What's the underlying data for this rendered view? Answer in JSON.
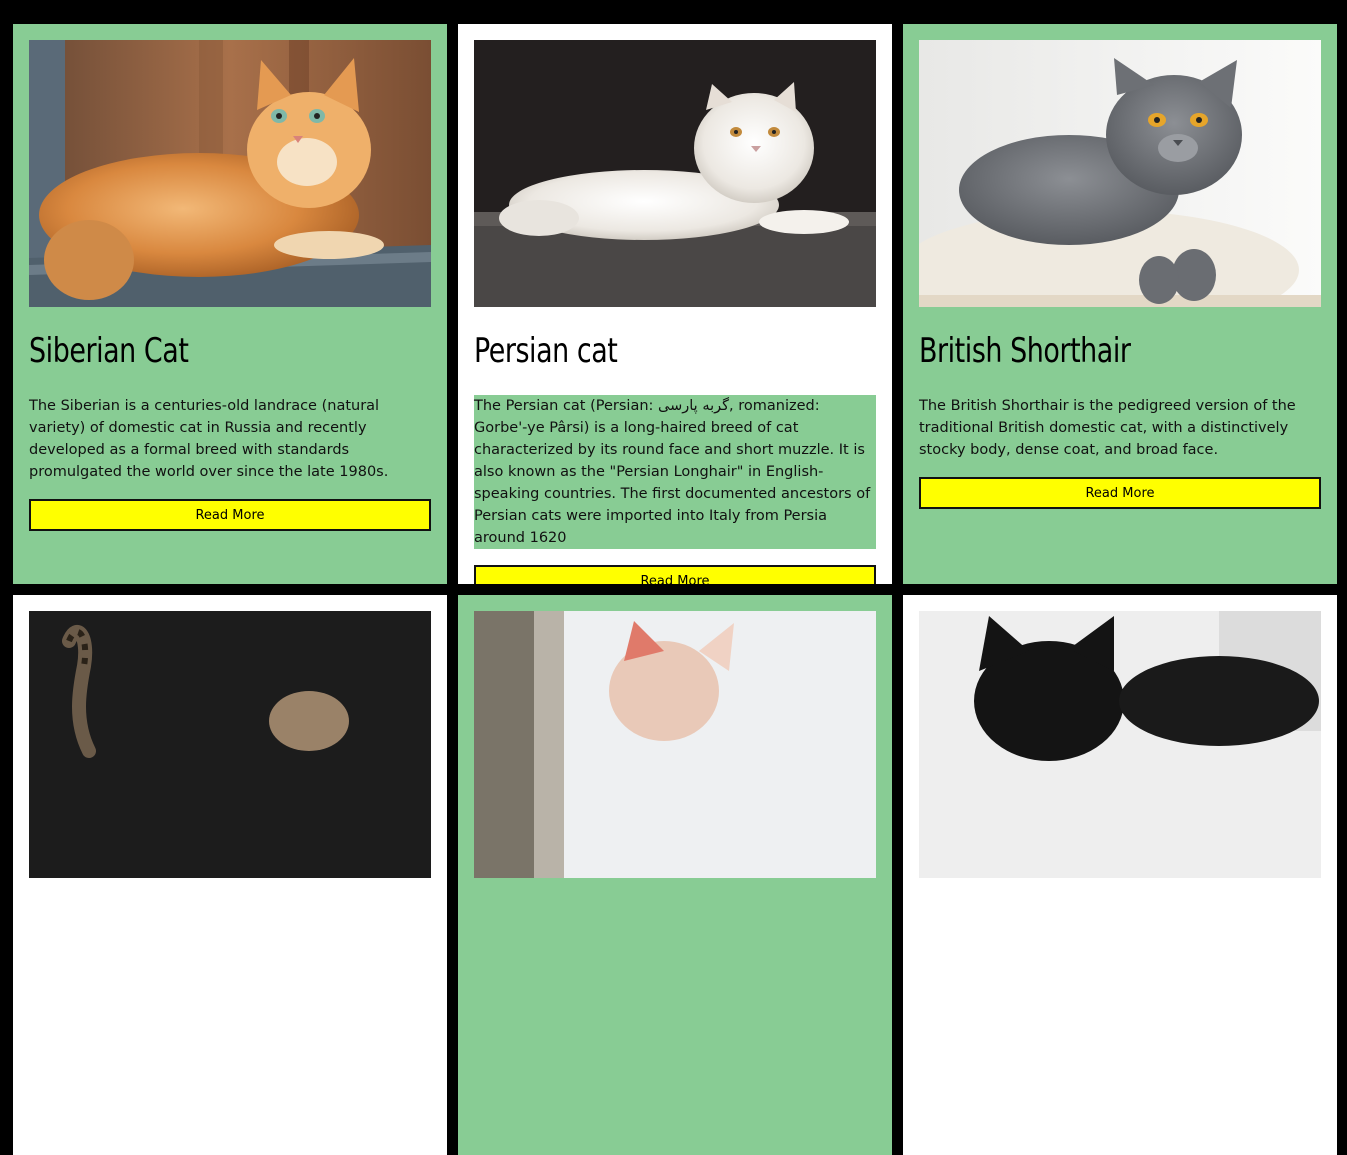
{
  "cards": [
    {
      "title": "Siberian Cat",
      "description": "The Siberian is a centuries-old landrace (natural variety) of domestic cat in Russia and recently developed as a formal breed with standards promulgated the world over since the late 1980s.",
      "button_label": "Read More",
      "bg": "#88cc94",
      "image": "siberian-cat-photo"
    },
    {
      "title": "Persian cat",
      "description": "The Persian cat (Persian: گربه پارسی, romanized: Gorbe'-ye Pârsi) is a long-haired breed of cat characterized by its round face and short muzzle. It is also known as the \"Persian Longhair\" in English-speaking countries. The first documented ancestors of Persian cats were imported into Italy from Persia around 1620",
      "button_label": "Read More",
      "bg": "#ffffff",
      "image": "persian-cat-photo"
    },
    {
      "title": "British Shorthair",
      "description": "The British Shorthair is the pedigreed version of the traditional British domestic cat, with a distinctively stocky body, dense coat, and broad face.",
      "button_label": "Read More",
      "bg": "#88cc94",
      "image": "british-shorthair-photo"
    },
    {
      "bg": "#ffffff",
      "image": "tabby-cat-photo"
    },
    {
      "bg": "#88cc94",
      "image": "sphynx-cat-photo"
    },
    {
      "bg": "#ffffff",
      "image": "black-cat-photo"
    }
  ],
  "colors": {
    "page_bg": "#000000",
    "card_green": "#88cc94",
    "card_white": "#ffffff",
    "button_bg": "#ffff00"
  }
}
